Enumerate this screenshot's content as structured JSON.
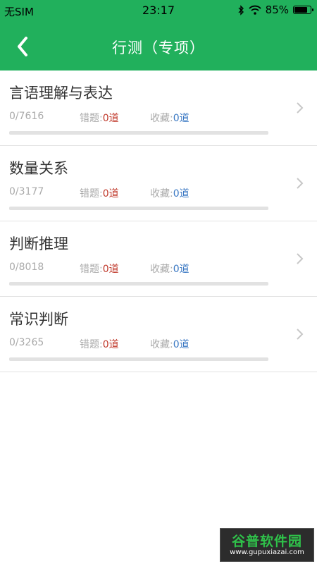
{
  "status_bar": {
    "carrier": "无SIM",
    "time": "23:17",
    "battery": "85%",
    "battery_level": 0.85,
    "icons": [
      "bluetooth-icon",
      "wifi-icon",
      "battery-icon"
    ]
  },
  "header": {
    "title": "行测（专项）",
    "back_icon": "chevron-left-icon"
  },
  "items": [
    {
      "title": "言语理解与表达",
      "progress": "0/7616",
      "wrong_label": "错题:",
      "wrong_value": "0道",
      "fav_label": "收藏:",
      "fav_value": "0道",
      "completion": 0
    },
    {
      "title": "数量关系",
      "progress": "0/3177",
      "wrong_label": "错题:",
      "wrong_value": "0道",
      "fav_label": "收藏:",
      "fav_value": "0道",
      "completion": 0
    },
    {
      "title": "判断推理",
      "progress": "0/8018",
      "wrong_label": "错题:",
      "wrong_value": "0道",
      "fav_label": "收藏:",
      "fav_value": "0道",
      "completion": 0
    },
    {
      "title": "常识判断",
      "progress": "0/3265",
      "wrong_label": "错题:",
      "wrong_value": "0道",
      "fav_label": "收藏:",
      "fav_value": "0道",
      "completion": 0
    }
  ],
  "watermark": {
    "title": "谷普软件园",
    "url": "www.gupuxiazai.com"
  },
  "colors": {
    "primary": "#21b05c",
    "wrong": "#c0392b",
    "favorite": "#3a78c3"
  }
}
